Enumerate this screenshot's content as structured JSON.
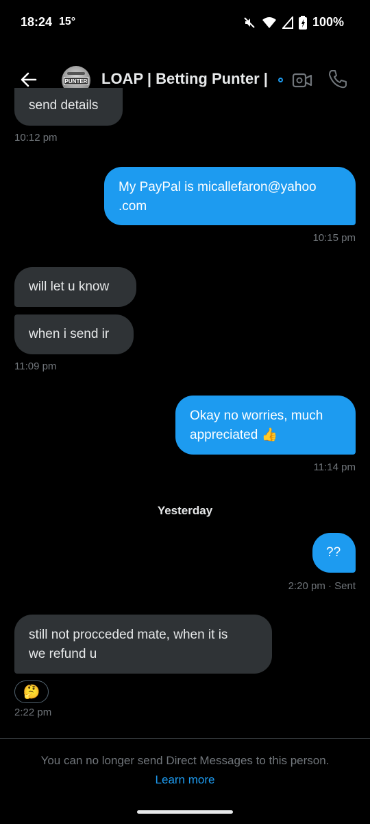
{
  "status_bar": {
    "time": "18:24",
    "temperature": "15°",
    "battery": "100%"
  },
  "header": {
    "title": "LOAP | Betting Punter |",
    "avatar_text": "PUNTER"
  },
  "messages": [
    {
      "direction": "in",
      "text": "send details"
    },
    {
      "timestamp": "10:12 pm"
    },
    {
      "direction": "out",
      "line1": "My PayPal is micallefaron@yahoo",
      "line2": ".com"
    },
    {
      "timestamp": "10:15 pm"
    },
    {
      "direction": "in",
      "text": "will let u know"
    },
    {
      "direction": "in",
      "text": "when i send ir"
    },
    {
      "timestamp": "11:09 pm"
    },
    {
      "direction": "out",
      "line1": "Okay no worries, much",
      "line2": "appreciated 👍"
    },
    {
      "timestamp": "11:14 pm"
    },
    {
      "direction": "out",
      "text": "??"
    },
    {
      "timestamp": "2:20 pm · Sent"
    },
    {
      "direction": "in",
      "line1": "still not procceded mate, when it is",
      "line2": "we refund u"
    },
    {
      "reaction": "🤔"
    },
    {
      "timestamp": "2:22 pm"
    }
  ],
  "divider": "Yesterday",
  "footer": {
    "notice": "You can no longer send Direct Messages to this person.",
    "link": "Learn more"
  },
  "colors": {
    "accent": "#1d9bf0",
    "incoming_bubble": "#2f3336",
    "muted_text": "#71767b",
    "background": "#000000"
  },
  "icons": [
    "back-arrow-icon",
    "video-camera-icon",
    "phone-icon",
    "mute-icon",
    "wifi-icon",
    "signal-icon",
    "battery-icon"
  ]
}
